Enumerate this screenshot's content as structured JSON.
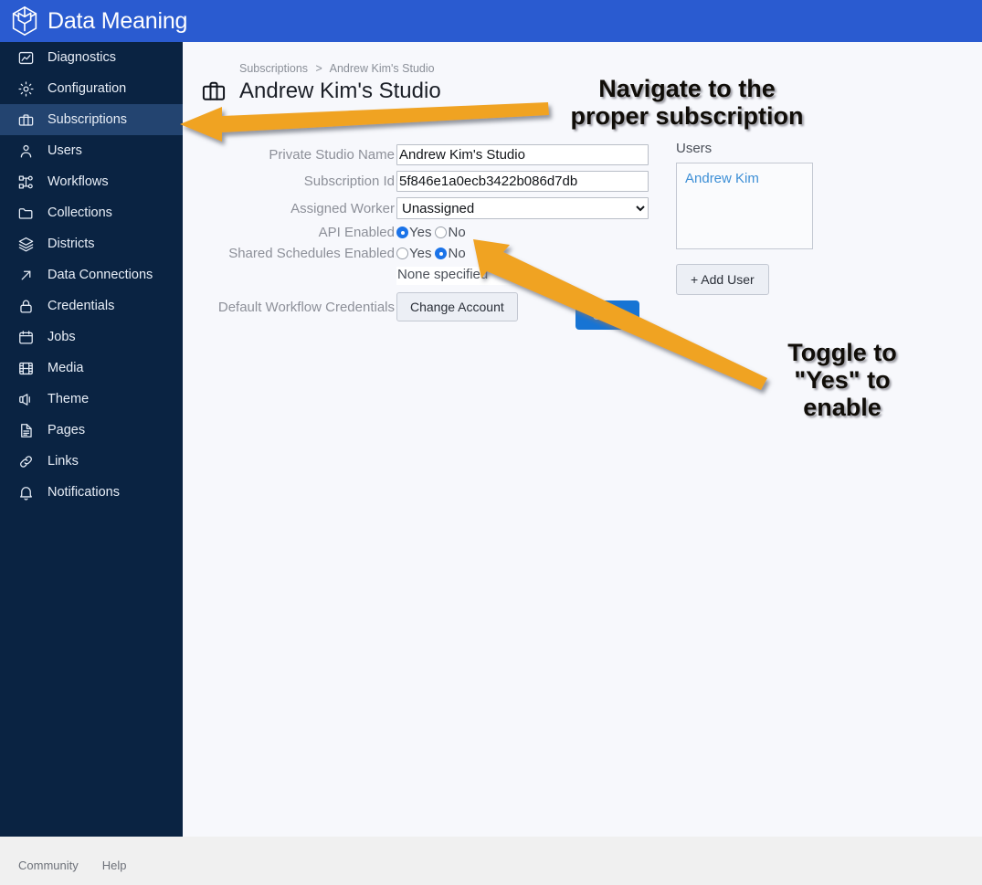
{
  "colors": {
    "topbar": "#2a5bd0",
    "sidebar": "#0a2342",
    "sidebar_active": "#234470",
    "accent_blue": "#1774d4",
    "annotation_orange": "#f0a322",
    "link_blue": "#3d8fd6"
  },
  "topbar": {
    "logo_icon": "cube-hexagon-logo-icon",
    "brand": "Data Meaning"
  },
  "sidebar": {
    "items": [
      {
        "label": "Diagnostics",
        "icon": "chart-image-icon",
        "active": false
      },
      {
        "label": "Configuration",
        "icon": "gear-icon",
        "active": false
      },
      {
        "label": "Subscriptions",
        "icon": "briefcase-icon",
        "active": true
      },
      {
        "label": "Users",
        "icon": "person-icon",
        "active": false
      },
      {
        "label": "Workflows",
        "icon": "workflow-nodes-icon",
        "active": false
      },
      {
        "label": "Collections",
        "icon": "folder-icon",
        "active": false
      },
      {
        "label": "Districts",
        "icon": "layers-icon",
        "active": false
      },
      {
        "label": "Data Connections",
        "icon": "arrow-up-right-icon",
        "active": false
      },
      {
        "label": "Credentials",
        "icon": "lock-icon",
        "active": false
      },
      {
        "label": "Jobs",
        "icon": "calendar-icon",
        "active": false
      },
      {
        "label": "Media",
        "icon": "film-grid-icon",
        "active": false
      },
      {
        "label": "Theme",
        "icon": "megaphone-icon",
        "active": false
      },
      {
        "label": "Pages",
        "icon": "document-icon",
        "active": false
      },
      {
        "label": "Links",
        "icon": "link-chain-icon",
        "active": false
      },
      {
        "label": "Notifications",
        "icon": "bell-icon",
        "active": false
      }
    ]
  },
  "main": {
    "breadcrumb": {
      "root": "Subscriptions",
      "separator": ">",
      "current": "Andrew Kim's Studio"
    },
    "page_icon": "briefcase-icon",
    "page_title": "Andrew Kim's Studio",
    "form": {
      "private_studio_name": {
        "label": "Private Studio Name",
        "value": "Andrew Kim's Studio",
        "placeholder": ""
      },
      "subscription_id": {
        "label": "Subscription Id",
        "value": "5f846e1a0ecb3422b086d7db",
        "placeholder": ""
      },
      "assigned_worker": {
        "label": "Assigned Worker",
        "value": "Unassigned",
        "options": [
          "Unassigned"
        ]
      },
      "api_enabled": {
        "label": "API Enabled",
        "yes_label": "Yes",
        "no_label": "No",
        "selected": "Yes"
      },
      "shared_schedules_enabled": {
        "label": "Shared Schedules Enabled",
        "yes_label": "Yes",
        "no_label": "No",
        "selected": "No"
      },
      "default_workflow_credentials": {
        "label": "Default Workflow Credentials",
        "value": "None specified",
        "button_label": "Change Account"
      },
      "save_label": "Save"
    },
    "users": {
      "title": "Users",
      "list": [
        "Andrew Kim"
      ],
      "add_button_label": "+ Add User"
    }
  },
  "footer": {
    "links": [
      "Community",
      "Help"
    ]
  },
  "annotations": [
    {
      "id": "navigate",
      "text": "Navigate to the\nproper subscription"
    },
    {
      "id": "toggle",
      "text": "Toggle to\n\"Yes\" to\nenable"
    }
  ]
}
